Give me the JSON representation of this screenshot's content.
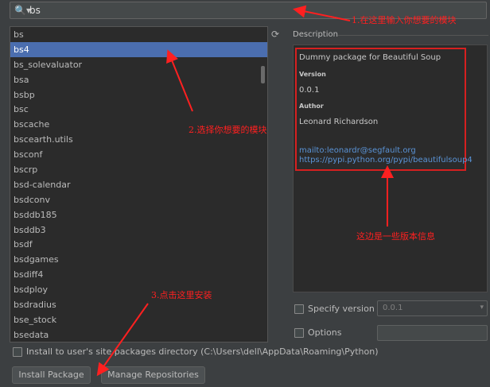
{
  "search": {
    "icon": "search-icon",
    "value": "bs"
  },
  "packages": [
    "bs",
    "bs4",
    "bs_solevaluator",
    "bsa",
    "bsbp",
    "bsc",
    "bscache",
    "bscearth.utils",
    "bsconf",
    "bscrp",
    "bsd-calendar",
    "bsdconv",
    "bsddb185",
    "bsddb3",
    "bsdf",
    "bsdgames",
    "bsdiff4",
    "bsdploy",
    "bsdradius",
    "bse_stock",
    "bsedata"
  ],
  "selected_package": "bs4",
  "description": {
    "title": "Description",
    "summary": "Dummy package for Beautiful Soup",
    "version_label": "Version",
    "version": "0.0.1",
    "author_label": "Author",
    "author": "Leonard Richardson",
    "email": "mailto:leonardr@segfault.org",
    "url": "https://pypi.python.org/pypi/beautifulsoup4"
  },
  "options": {
    "specify_version_label": "Specify version",
    "specify_version_value": "0.0.1",
    "options_label": "Options",
    "install_user_label": "Install to user's site packages directory (C:\\Users\\dell\\AppData\\Roaming\\Python)"
  },
  "buttons": {
    "install": "Install Package",
    "manage": "Manage Repositories"
  },
  "annotations": {
    "a1": "1.在这里输入你想要的模块",
    "a2": "2.选择你想要的模块",
    "a3": "3.点击这里安装",
    "a4": "这边是一些版本信息"
  },
  "colors": {
    "selection": "#4b6eaf",
    "annotation": "#ff2020",
    "link": "#5a93d6"
  }
}
